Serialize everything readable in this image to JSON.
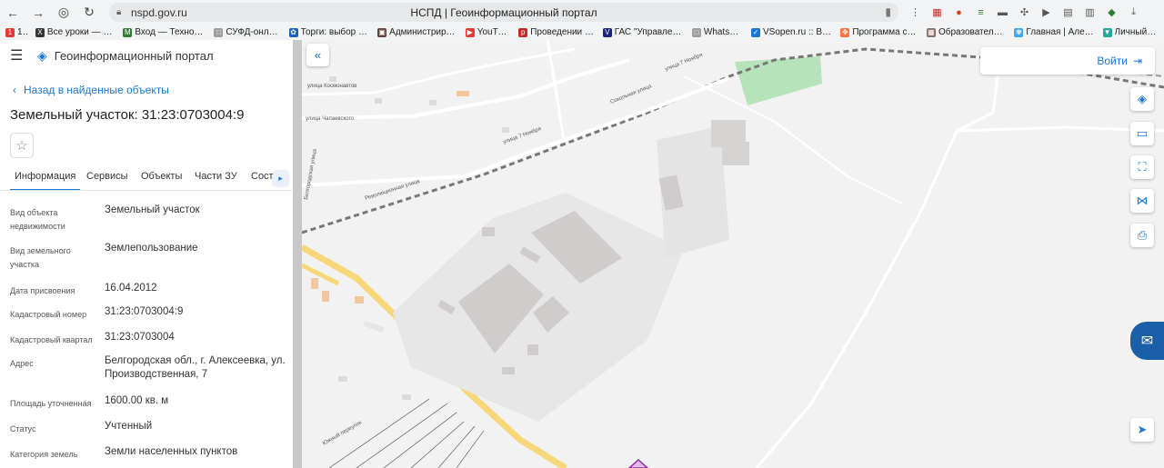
{
  "browser": {
    "url": "nspd.gov.ru",
    "tab_title": "НСПД | Геоинформационный портал",
    "bookmarks": [
      {
        "label": "1С",
        "color": "#e53935",
        "glyph": "1"
      },
      {
        "label": "Все уроки — Уро",
        "color": "#333333",
        "glyph": "X"
      },
      {
        "label": "Вход — ТехноКад",
        "color": "#2e7d32",
        "glyph": "M"
      },
      {
        "label": "СУФД-онлайн",
        "color": "#9e9e9e",
        "glyph": "□"
      },
      {
        "label": "Торги: выбор вер",
        "color": "#1565c0",
        "glyph": "✿"
      },
      {
        "label": "Администрирова",
        "color": "#5d4037",
        "glyph": "▣"
      },
      {
        "label": "YouTube",
        "color": "#e53935",
        "glyph": "▶"
      },
      {
        "label": "Проведении аук",
        "color": "#c62828",
        "glyph": "p"
      },
      {
        "label": "ГАС \"Управление",
        "color": "#1a237e",
        "glyph": "V"
      },
      {
        "label": "WhatsApp",
        "color": "#9e9e9e",
        "glyph": "□"
      },
      {
        "label": "VSopen.ru :: Вирт",
        "color": "#1976d2",
        "glyph": "✓"
      },
      {
        "label": "Программа спор",
        "color": "#ff7043",
        "glyph": "✤"
      },
      {
        "label": "Образовательны",
        "color": "#8d6e63",
        "glyph": "▦"
      },
      {
        "label": "Главная | Алексе",
        "color": "#42a5f5",
        "glyph": "✾"
      },
      {
        "label": "Личный ка",
        "color": "#26a69a",
        "glyph": "▼"
      }
    ]
  },
  "app": {
    "name": "Геоинформационный портал",
    "back_label": "Назад в найденные объекты",
    "title": "Земельный участок: 31:23:0703004:9",
    "tabs": [
      "Информация",
      "Сервисы",
      "Объекты",
      "Части ЗУ",
      "Состав"
    ],
    "active_tab": 0,
    "login_label": "Войти"
  },
  "properties": [
    {
      "key": "Вид объекта недвижимости",
      "value": "Земельный участок"
    },
    {
      "key": "Вид земельного участка",
      "value": "Землепользование"
    },
    {
      "key": "Дата присвоения",
      "value": "16.04.2012"
    },
    {
      "key": "Кадастровый номер",
      "value": "31:23:0703004:9"
    },
    {
      "key": "Кадастровый квартал",
      "value": "31:23:0703004"
    },
    {
      "key": "Адрес",
      "value": "Белгородская обл., г. Алексеевка, ул. Производственная, 7"
    },
    {
      "key": "Площадь уточненная",
      "value": "1600.00 кв. м"
    },
    {
      "key": "Статус",
      "value": "Учтенный"
    },
    {
      "key": "Категория земель",
      "value": "Земли населенных пунктов"
    }
  ],
  "map": {
    "streets": [
      "улица Космонавтов",
      "улица Чапаевского",
      "улица 7 Ноября",
      "Революционная улица",
      "Сокольная улица",
      "улица 7 Ноября",
      "Южный переулок",
      "Белгородская улица"
    ]
  },
  "colors": {
    "accent": "#1976d2",
    "map_bg": "#f2f2f2",
    "green": "#b6e3b9",
    "road": "#f6d77a",
    "building": "#cfcccb",
    "parcel": "#9c27b0"
  }
}
